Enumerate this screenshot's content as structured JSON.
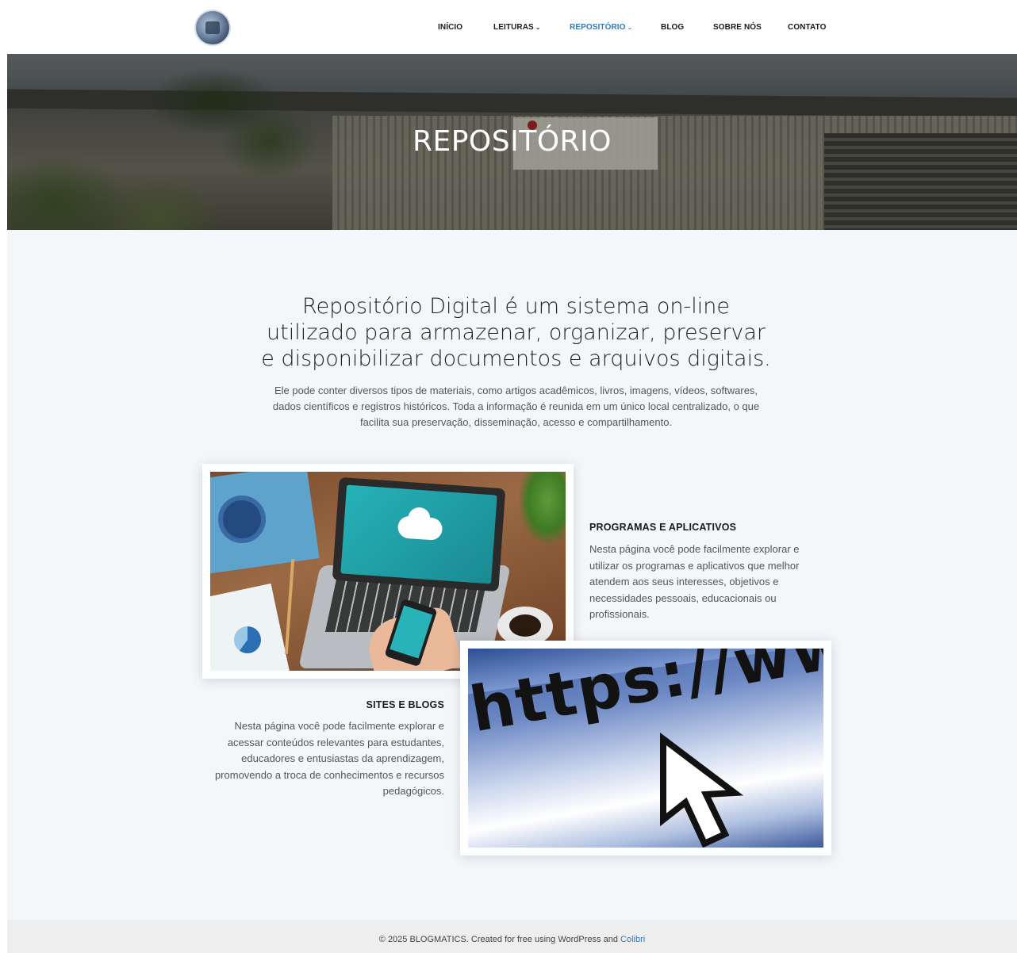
{
  "nav": {
    "items": [
      {
        "label": "INÍCIO",
        "has_dropdown": false
      },
      {
        "label": "LEITURAS",
        "has_dropdown": true
      },
      {
        "label": "REPOSITÓRIO",
        "has_dropdown": true,
        "active": true
      },
      {
        "label": "BLOG",
        "has_dropdown": false
      },
      {
        "label": "SOBRE NÓS",
        "has_dropdown": false
      },
      {
        "label": "CONTATO",
        "has_dropdown": false
      }
    ],
    "chevron": "⌄",
    "active_color": "#2f7bbf"
  },
  "hero": {
    "title": "REPOSITÓRIO"
  },
  "intro": {
    "headline": "Repositório Digital é um sistema on-line utilizado para armazenar, organizar, preservar e disponibilizar documentos e arquivos digitais.",
    "body": "Ele pode conter diversos tipos de materiais, como artigos acadêmicos, livros, imagens, vídeos, softwares, dados científicos e registros históricos. Toda a informação é reunida em um único local centralizado, o que facilita sua preservação, disseminação, acesso e compartilhamento."
  },
  "features": [
    {
      "title": "PROGRAMAS E APLICATIVOS",
      "text": "Nesta página você pode facilmente explorar e utilizar os programas e aplicativos que melhor atendem aos seus interesses, objetivos e necessidades pessoais, educacionais ou profissionais."
    },
    {
      "title": "SITES E BLOGS",
      "text": "Nesta página você pode facilmente explorar e acessar conteúdos relevantes para estudantes, educadores e entusiastas da aprendizagem, promovendo a troca de conhecimentos e recursos pedagógicos."
    }
  ],
  "images": {
    "url_image_text": "https://www"
  },
  "footer": {
    "text": "© 2025 BLOGMATICS. Created for free using WordPress and",
    "link": "Colibri"
  }
}
